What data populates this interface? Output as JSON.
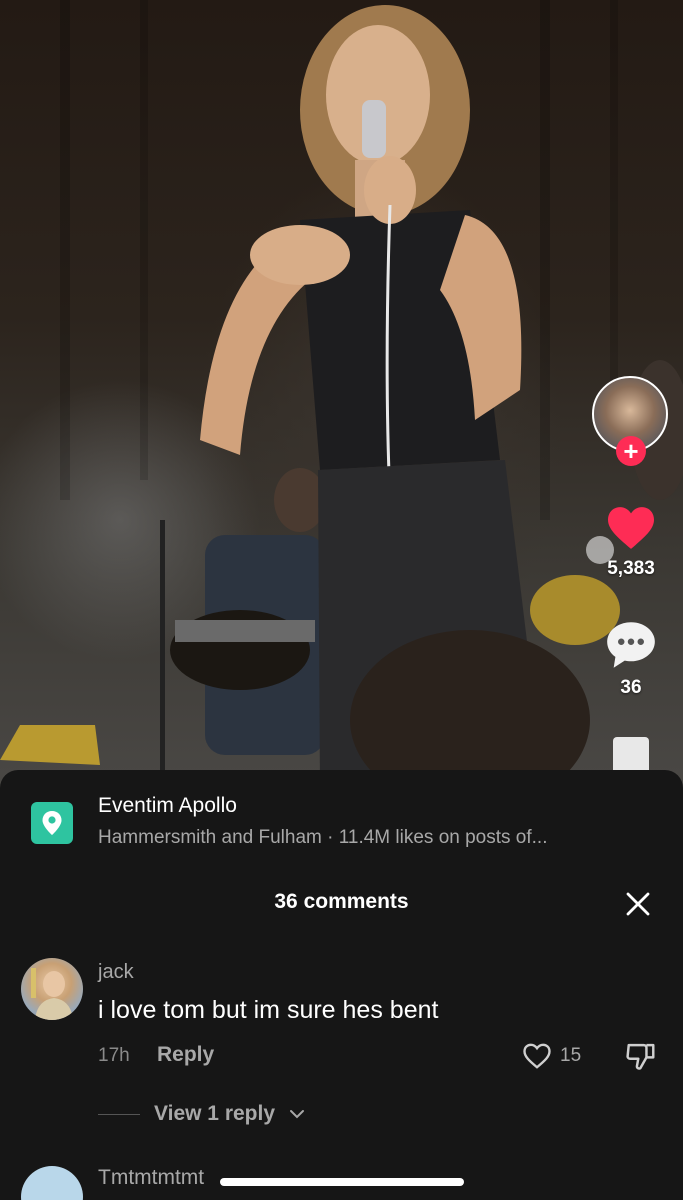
{
  "video": {
    "like_count": "5,383",
    "comment_count": "36"
  },
  "location": {
    "name": "Eventim Apollo",
    "subtitle": "Hammersmith and Fulham · 11.4M likes on posts of..."
  },
  "comments_sheet": {
    "title": "36 comments",
    "comments": [
      {
        "username": "jack",
        "text": "i love tom but im sure hes bent",
        "time": "17h",
        "reply_label": "Reply",
        "like_count": "15",
        "view_replies_label": "View 1 reply"
      },
      {
        "username": "Tmtmtmtmt"
      }
    ]
  },
  "colors": {
    "like_red": "#fe2c55",
    "location_icon": "#2ec4a0",
    "sheet_bg": "#161616"
  },
  "icons": [
    "follow-plus-icon",
    "heart-icon",
    "comment-bubble-icon",
    "location-pin-icon",
    "close-icon",
    "heart-outline-icon",
    "thumbs-down-icon",
    "chevron-down-icon"
  ]
}
